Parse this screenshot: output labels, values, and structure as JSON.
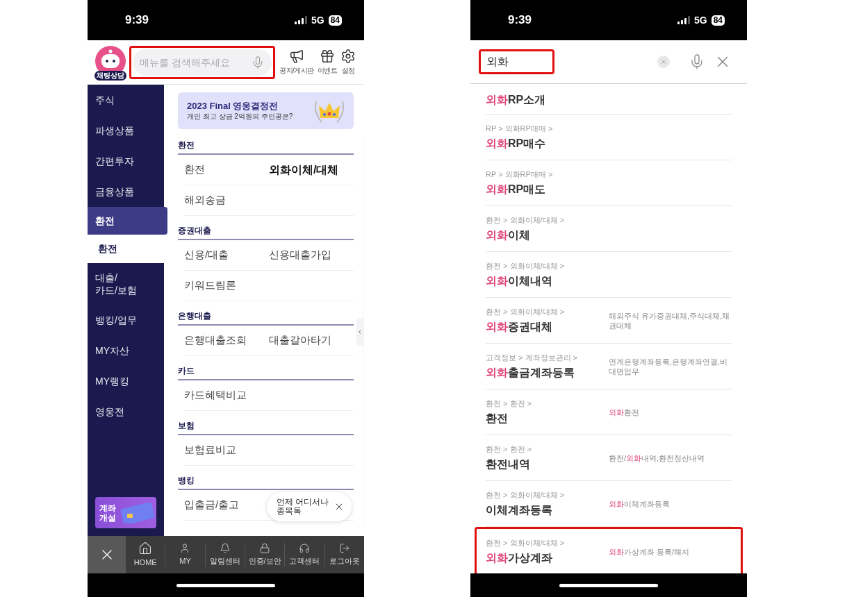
{
  "left_screen": {
    "status_bar": {
      "time": "9:39",
      "network": "5G",
      "battery": "84"
    },
    "header": {
      "chatbot_label": "채팅상담",
      "search": {
        "placeholder": "메뉴를 검색해주세요",
        "annotated": true
      },
      "actions": [
        {
          "kind": "notice",
          "label": "공지/게시판"
        },
        {
          "kind": "event",
          "label": "이벤트"
        },
        {
          "kind": "settings",
          "label": "설정"
        }
      ]
    },
    "sidebar": {
      "items": [
        {
          "label": "주식",
          "selected": false
        },
        {
          "label": "파생상품",
          "selected": false
        },
        {
          "label": "간편투자",
          "selected": false
        },
        {
          "label": "금융상품",
          "selected": false
        },
        {
          "label": "환전",
          "selected": true,
          "children": [
            {
              "label": "환전",
              "selected": true
            }
          ]
        },
        {
          "label": "대출/ 카드/보험",
          "selected": false
        },
        {
          "label": "뱅킹/업무",
          "selected": false
        },
        {
          "label": "MY자산",
          "selected": false
        },
        {
          "label": "MY랭킹",
          "selected": false
        },
        {
          "label": "영웅전",
          "selected": false
        }
      ],
      "open_account": "계좌 개설"
    },
    "banner": {
      "title": "2023 Final 영웅결정전",
      "subtitle": "개인 최고 상금 2억원의 주인공은?"
    },
    "sections": [
      {
        "heading": "환전",
        "rows": [
          [
            {
              "label": "환전",
              "selected": false
            },
            {
              "label": "외화이체/대체",
              "selected": true
            }
          ],
          [
            {
              "label": "해외송금",
              "selected": false
            }
          ]
        ]
      },
      {
        "heading": "증권대출",
        "rows": [
          [
            {
              "label": "신용/대출",
              "selected": false
            },
            {
              "label": "신용대출가입",
              "selected": false
            }
          ],
          [
            {
              "label": "키워드림론",
              "selected": false
            }
          ]
        ]
      },
      {
        "heading": "은행대출",
        "rows": [
          [
            {
              "label": "은행대출조회",
              "selected": false
            },
            {
              "label": "대출갈아타기",
              "selected": false
            }
          ]
        ]
      },
      {
        "heading": "카드",
        "rows": [
          [
            {
              "label": "카드혜택비교",
              "selected": false
            }
          ]
        ]
      },
      {
        "heading": "보험",
        "rows": [
          [
            {
              "label": "보험료비교",
              "selected": false
            }
          ]
        ]
      },
      {
        "heading": "뱅킹",
        "rows": [
          [
            {
              "label": "입출금/출고",
              "selected": false
            }
          ]
        ]
      }
    ],
    "toast": {
      "text": "언제 어디서나 종목톡"
    },
    "tab_bar": [
      {
        "kind": "close"
      },
      {
        "kind": "home",
        "label": "HOME"
      },
      {
        "kind": "my",
        "label": "MY"
      },
      {
        "kind": "alerts",
        "label": "알림센터"
      },
      {
        "kind": "security",
        "label": "인증/보안"
      },
      {
        "kind": "support",
        "label": "고객센터"
      },
      {
        "kind": "logout",
        "label": "로그아웃"
      }
    ]
  },
  "right_screen": {
    "status_bar": {
      "time": "9:39",
      "network": "5G",
      "battery": "84"
    },
    "search": {
      "value": "외화",
      "annotated": true
    },
    "results": [
      {
        "title": [
          {
            "text": "외화",
            "match": true
          },
          {
            "text": "RP소개",
            "match": false
          }
        ],
        "annotated": false
      },
      {
        "breadcrumb": "RP > 외화RP매매 >",
        "title": [
          {
            "text": "외화",
            "match": true
          },
          {
            "text": "RP매수",
            "match": false
          }
        ],
        "annotated": false
      },
      {
        "breadcrumb": "RP > 외화RP매매 >",
        "title": [
          {
            "text": "외화",
            "match": true
          },
          {
            "text": "RP매도",
            "match": false
          }
        ],
        "annotated": false
      },
      {
        "breadcrumb": "환전 > 외화이체/대체 >",
        "title": [
          {
            "text": "외화",
            "match": true
          },
          {
            "text": "이체",
            "match": false
          }
        ],
        "annotated": false
      },
      {
        "breadcrumb": "환전 > 외화이체/대체 >",
        "title": [
          {
            "text": "외화",
            "match": true
          },
          {
            "text": "이체내역",
            "match": false
          }
        ],
        "annotated": false
      },
      {
        "breadcrumb": "환전 > 외화이체/대체 >",
        "title": [
          {
            "text": "외화",
            "match": true
          },
          {
            "text": "증권대체",
            "match": false
          }
        ],
        "description": [
          {
            "text": "해외주식 유가증권대체,주식대체,채권대체",
            "match": false
          }
        ],
        "annotated": false
      },
      {
        "breadcrumb": "고객정보 > 계좌정보관리 >",
        "title": [
          {
            "text": "외화",
            "match": true
          },
          {
            "text": "출금계좌등록",
            "match": false
          }
        ],
        "description": [
          {
            "text": "연계은행계좌등록,은행계좌연결,비대면업무",
            "match": false
          }
        ],
        "annotated": false
      },
      {
        "breadcrumb": "환전 > 환전 >",
        "title": [
          {
            "text": "환전",
            "match": false
          }
        ],
        "description": [
          {
            "text": "외화",
            "match": true
          },
          {
            "text": "환전",
            "match": false
          }
        ],
        "annotated": false
      },
      {
        "breadcrumb": "환전 > 환전 >",
        "title": [
          {
            "text": "환전내역",
            "match": false
          }
        ],
        "description": [
          {
            "text": "환전/",
            "match": false
          },
          {
            "text": "외화",
            "match": true
          },
          {
            "text": "내역,환전정산내역",
            "match": false
          }
        ],
        "annotated": false
      },
      {
        "breadcrumb": "환전 > 외화이체/대체 >",
        "title": [
          {
            "text": "이체계좌등록",
            "match": false
          }
        ],
        "description": [
          {
            "text": "외화",
            "match": true
          },
          {
            "text": "이체계좌등록",
            "match": false
          }
        ],
        "annotated": false
      },
      {
        "breadcrumb": "환전 > 외화이체/대체 >",
        "title": [
          {
            "text": "외화",
            "match": true
          },
          {
            "text": "가상계좌",
            "match": false
          }
        ],
        "description": [
          {
            "text": "외화",
            "match": true
          },
          {
            "text": "가상계좌 등록/해지",
            "match": false
          }
        ],
        "annotated": true
      }
    ]
  }
}
